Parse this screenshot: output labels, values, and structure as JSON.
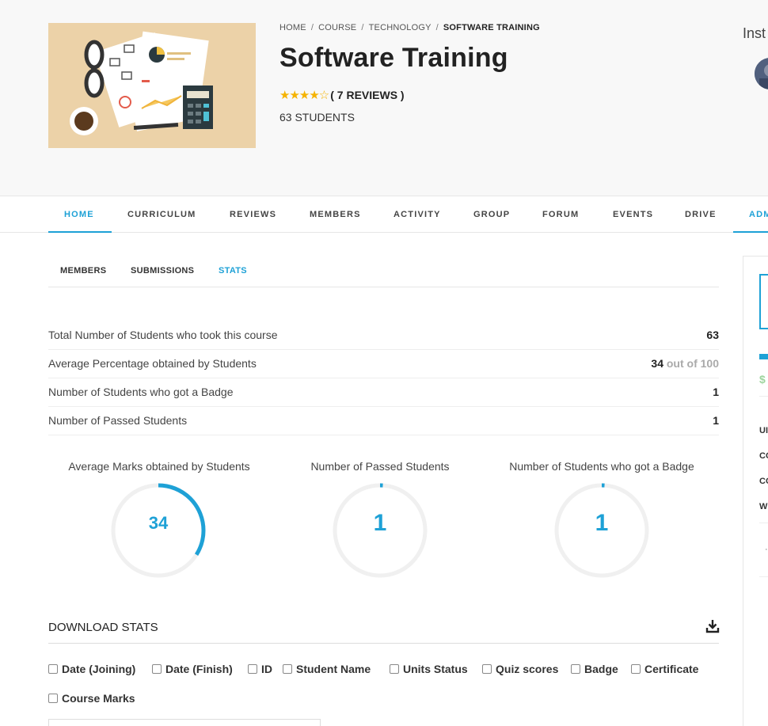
{
  "header": {
    "breadcrumb": [
      "HOME",
      "COURSE",
      "TECHNOLOGY",
      "SOFTWARE TRAINING"
    ],
    "title": "Software Training",
    "stars": "★★★★☆",
    "rating_value": 4.5,
    "reviews": "( 7 REVIEWS )",
    "students": "63 STUDENTS",
    "instructor_label": "Inst"
  },
  "main_nav": [
    "HOME",
    "CURRICULUM",
    "REVIEWS",
    "MEMBERS",
    "ACTIVITY",
    "GROUP",
    "FORUM",
    "EVENTS",
    "DRIVE",
    "ADM"
  ],
  "sub_nav": [
    "MEMBERS",
    "SUBMISSIONS",
    "STATS"
  ],
  "stats": [
    {
      "label": "Total Number of Students who took this course",
      "value": "63",
      "suffix": ""
    },
    {
      "label": "Average Percentage obtained by Students",
      "value": "34",
      "suffix": "out of 100"
    },
    {
      "label": "Number of Students who got a Badge",
      "value": "1",
      "suffix": ""
    },
    {
      "label": "Number of Passed Students",
      "value": "1",
      "suffix": ""
    }
  ],
  "gauges": [
    {
      "title": "Average Marks obtained by Students",
      "value": "34",
      "fraction": 0.34
    },
    {
      "title": "Number of Passed Students",
      "value": "1",
      "fraction": 0.01
    },
    {
      "title": "Number of Students who got a Badge",
      "value": "1",
      "fraction": 0.01
    }
  ],
  "download": {
    "title": "DOWNLOAD STATS",
    "options": [
      "Date (Joining)",
      "Date (Finish)",
      "ID",
      "Student Name",
      "Units Status",
      "Quiz scores",
      "Badge",
      "Certificate",
      "Course Marks"
    ]
  },
  "sidebar": {
    "price_fragment": "$",
    "item_fragments": [
      "UI",
      "CC",
      "CC",
      "W"
    ],
    "footer_fragment": "·"
  },
  "colors": {
    "accent": "#1ea1d6",
    "star": "#f5b301",
    "gauge_track": "#f0f0f0"
  }
}
